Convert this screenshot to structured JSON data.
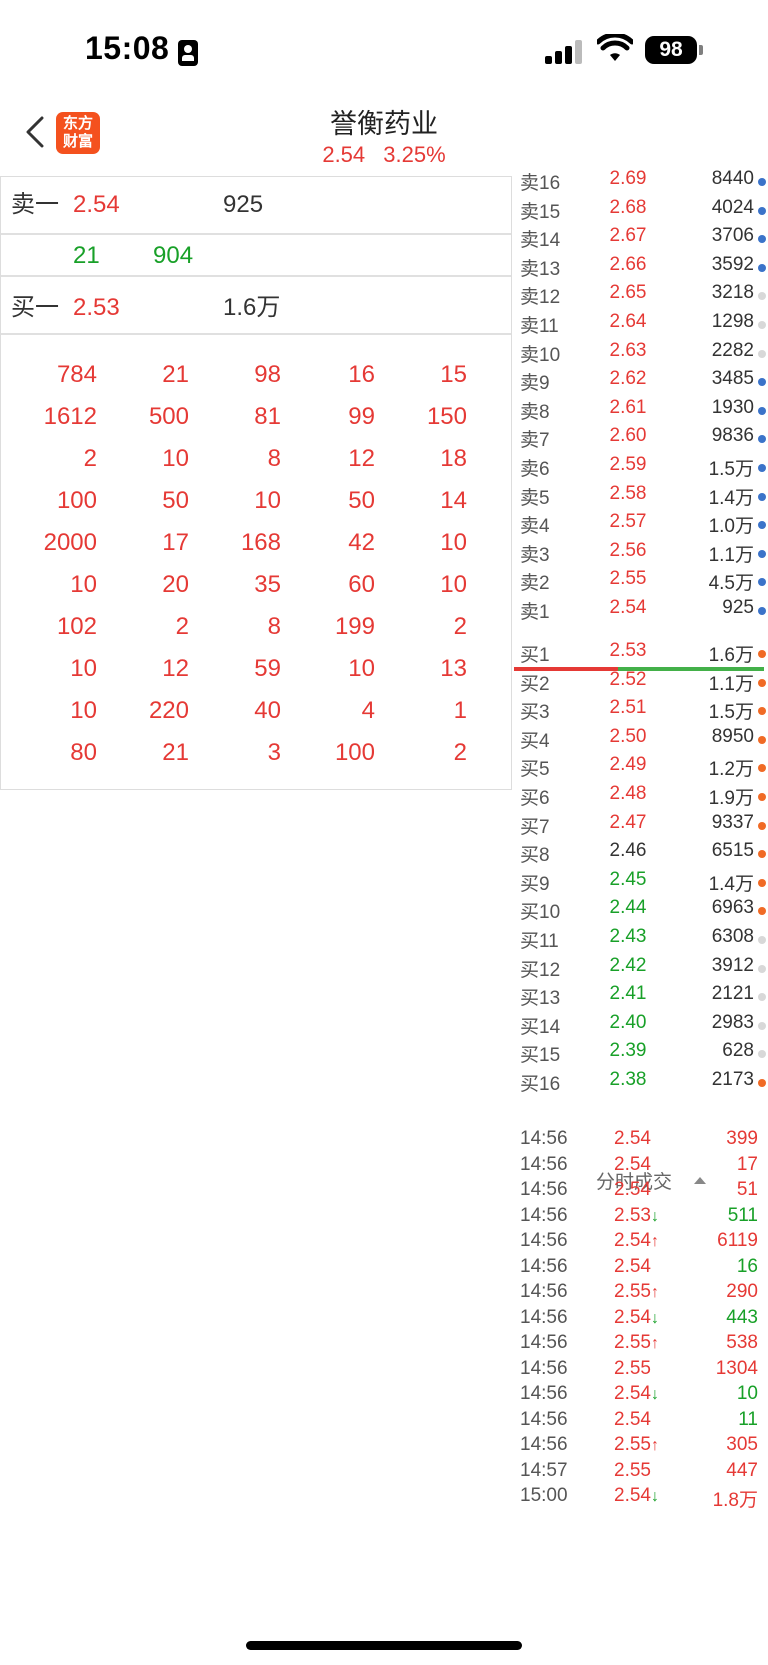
{
  "status_bar": {
    "time": "15:08",
    "battery": "98"
  },
  "header": {
    "title": "誉衡药业",
    "price": "2.54",
    "change_pct": "3.25%",
    "logo_line1": "东方",
    "logo_line2": "财富"
  },
  "left_panel": {
    "sell1": {
      "label": "卖一",
      "price": "2.54",
      "volume": "925"
    },
    "mid": {
      "a": "21",
      "b": "904"
    },
    "buy1": {
      "label": "买一",
      "price": "2.53",
      "volume": "1.6万"
    },
    "queue": [
      [
        "784",
        "21",
        "98",
        "16",
        "15"
      ],
      [
        "1612",
        "500",
        "81",
        "99",
        "150"
      ],
      [
        "2",
        "10",
        "8",
        "12",
        "18"
      ],
      [
        "100",
        "50",
        "10",
        "50",
        "14"
      ],
      [
        "2000",
        "17",
        "168",
        "42",
        "10"
      ],
      [
        "10",
        "20",
        "35",
        "60",
        "10"
      ],
      [
        "102",
        "2",
        "8",
        "199",
        "2"
      ],
      [
        "10",
        "12",
        "59",
        "10",
        "13"
      ],
      [
        "10",
        "220",
        "40",
        "4",
        "1"
      ],
      [
        "80",
        "21",
        "3",
        "100",
        "2"
      ]
    ]
  },
  "depth": {
    "asks": [
      {
        "label": "卖16",
        "price": "2.69",
        "vol": "8440",
        "dot": "#3b73c9"
      },
      {
        "label": "卖15",
        "price": "2.68",
        "vol": "4024",
        "dot": "#3b73c9"
      },
      {
        "label": "卖14",
        "price": "2.67",
        "vol": "3706",
        "dot": "#3b73c9"
      },
      {
        "label": "卖13",
        "price": "2.66",
        "vol": "3592",
        "dot": "#3b73c9"
      },
      {
        "label": "卖12",
        "price": "2.65",
        "vol": "3218",
        "dot": "#d8d8d8"
      },
      {
        "label": "卖11",
        "price": "2.64",
        "vol": "1298",
        "dot": "#d8d8d8"
      },
      {
        "label": "卖10",
        "price": "2.63",
        "vol": "2282",
        "dot": "#d8d8d8"
      },
      {
        "label": "卖9",
        "price": "2.62",
        "vol": "3485",
        "dot": "#3b73c9"
      },
      {
        "label": "卖8",
        "price": "2.61",
        "vol": "1930",
        "dot": "#3b73c9"
      },
      {
        "label": "卖7",
        "price": "2.60",
        "vol": "9836",
        "dot": "#3b73c9"
      },
      {
        "label": "卖6",
        "price": "2.59",
        "vol": "1.5万",
        "dot": "#3b73c9"
      },
      {
        "label": "卖5",
        "price": "2.58",
        "vol": "1.4万",
        "dot": "#3b73c9"
      },
      {
        "label": "卖4",
        "price": "2.57",
        "vol": "1.0万",
        "dot": "#3b73c9"
      },
      {
        "label": "卖3",
        "price": "2.56",
        "vol": "1.1万",
        "dot": "#3b73c9"
      },
      {
        "label": "卖2",
        "price": "2.55",
        "vol": "4.5万",
        "dot": "#3b73c9"
      },
      {
        "label": "卖1",
        "price": "2.54",
        "vol": "925",
        "dot": "#3b73c9"
      }
    ],
    "bids": [
      {
        "label": "买1",
        "price": "2.53",
        "vol": "1.6万",
        "dot": "#f06a25",
        "pc": "red"
      },
      {
        "label": "买2",
        "price": "2.52",
        "vol": "1.1万",
        "dot": "#f06a25",
        "pc": "red"
      },
      {
        "label": "买3",
        "price": "2.51",
        "vol": "1.5万",
        "dot": "#f06a25",
        "pc": "red"
      },
      {
        "label": "买4",
        "price": "2.50",
        "vol": "8950",
        "dot": "#f06a25",
        "pc": "red"
      },
      {
        "label": "买5",
        "price": "2.49",
        "vol": "1.2万",
        "dot": "#f06a25",
        "pc": "red"
      },
      {
        "label": "买6",
        "price": "2.48",
        "vol": "1.9万",
        "dot": "#f06a25",
        "pc": "red"
      },
      {
        "label": "买7",
        "price": "2.47",
        "vol": "9337",
        "dot": "#f06a25",
        "pc": "red"
      },
      {
        "label": "买8",
        "price": "2.46",
        "vol": "6515",
        "dot": "#f06a25",
        "pc": "dark"
      },
      {
        "label": "买9",
        "price": "2.45",
        "vol": "1.4万",
        "dot": "#f06a25",
        "pc": "green"
      },
      {
        "label": "买10",
        "price": "2.44",
        "vol": "6963",
        "dot": "#f06a25",
        "pc": "green"
      },
      {
        "label": "买11",
        "price": "2.43",
        "vol": "6308",
        "dot": "#d8d8d8",
        "pc": "green"
      },
      {
        "label": "买12",
        "price": "2.42",
        "vol": "3912",
        "dot": "#d8d8d8",
        "pc": "green"
      },
      {
        "label": "买13",
        "price": "2.41",
        "vol": "2121",
        "dot": "#d8d8d8",
        "pc": "green"
      },
      {
        "label": "买14",
        "price": "2.40",
        "vol": "2983",
        "dot": "#d8d8d8",
        "pc": "green"
      },
      {
        "label": "买15",
        "price": "2.39",
        "vol": "628",
        "dot": "#d8d8d8",
        "pc": "green"
      },
      {
        "label": "买16",
        "price": "2.38",
        "vol": "2173",
        "dot": "#f06a25",
        "pc": "green"
      }
    ]
  },
  "ticks": {
    "title": "分时成交",
    "rows": [
      {
        "time": "14:56",
        "price": "2.54",
        "arrow": "",
        "vol": "399",
        "vc": "red"
      },
      {
        "time": "14:56",
        "price": "2.54",
        "arrow": "",
        "vol": "17",
        "vc": "red"
      },
      {
        "time": "14:56",
        "price": "2.54",
        "arrow": "",
        "vol": "51",
        "vc": "red"
      },
      {
        "time": "14:56",
        "price": "2.53",
        "arrow": "↓",
        "vol": "511",
        "vc": "green"
      },
      {
        "time": "14:56",
        "price": "2.54",
        "arrow": "↑",
        "vol": "6119",
        "vc": "red"
      },
      {
        "time": "14:56",
        "price": "2.54",
        "arrow": "",
        "vol": "16",
        "vc": "green"
      },
      {
        "time": "14:56",
        "price": "2.55",
        "arrow": "↑",
        "vol": "290",
        "vc": "red"
      },
      {
        "time": "14:56",
        "price": "2.54",
        "arrow": "↓",
        "vol": "443",
        "vc": "green"
      },
      {
        "time": "14:56",
        "price": "2.55",
        "arrow": "↑",
        "vol": "538",
        "vc": "red"
      },
      {
        "time": "14:56",
        "price": "2.55",
        "arrow": "",
        "vol": "1304",
        "vc": "red"
      },
      {
        "time": "14:56",
        "price": "2.54",
        "arrow": "↓",
        "vol": "10",
        "vc": "green"
      },
      {
        "time": "14:56",
        "price": "2.54",
        "arrow": "",
        "vol": "11",
        "vc": "green"
      },
      {
        "time": "14:56",
        "price": "2.55",
        "arrow": "↑",
        "vol": "305",
        "vc": "red"
      },
      {
        "time": "14:57",
        "price": "2.55",
        "arrow": "",
        "vol": "447",
        "vc": "red"
      },
      {
        "time": "15:00",
        "price": "2.54",
        "arrow": "↓",
        "vol": "1.8万",
        "vc": "red"
      }
    ]
  }
}
